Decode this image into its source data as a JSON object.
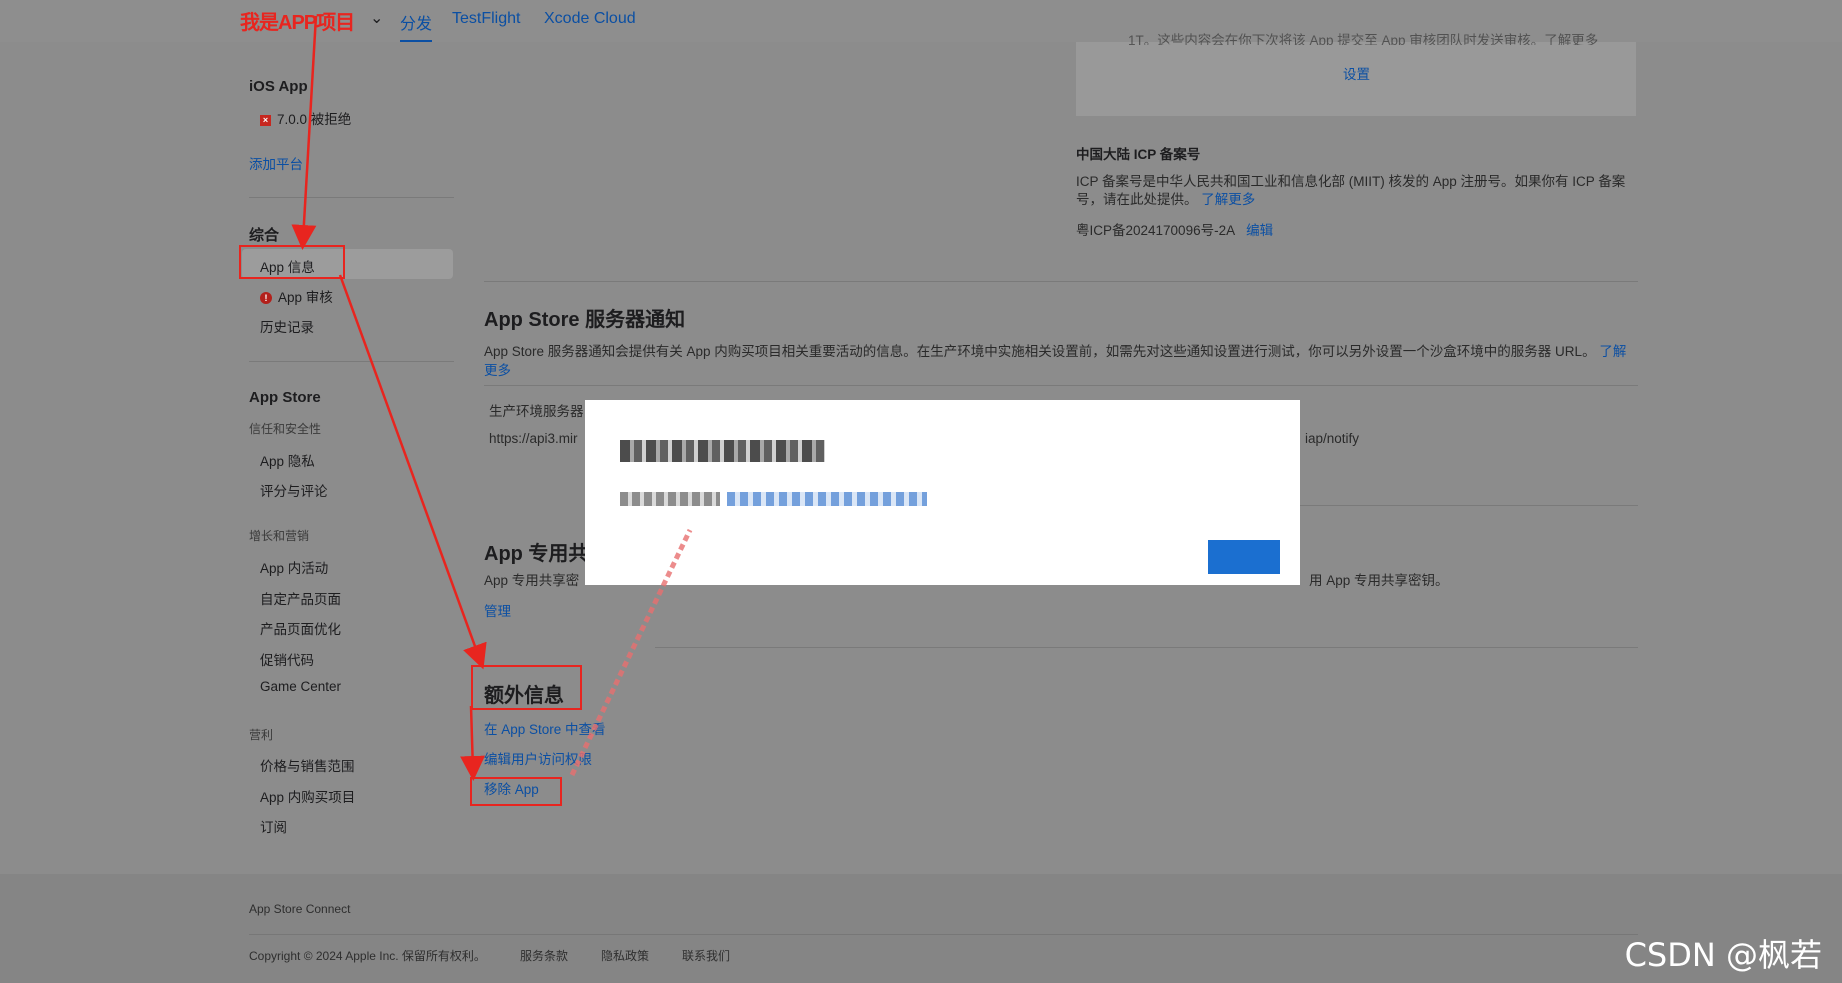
{
  "app_name": "我是APP项目",
  "nav": {
    "tabs": [
      "分发",
      "TestFlight",
      "Xcode Cloud"
    ]
  },
  "sidebar": {
    "ios_app_heading": "iOS App",
    "version_status": "7.0.0 被拒绝",
    "add_platform": "添加平台",
    "general_heading": "综合",
    "general_items": [
      "App 信息",
      "App 审核",
      "历史记录"
    ],
    "appstore_heading": "App Store",
    "trust_sub": "信任和安全性",
    "trust_items": [
      "App 隐私",
      "评分与评论"
    ],
    "growth_sub": "增长和营销",
    "growth_items": [
      "App 内活动",
      "自定产品页面",
      "产品页面优化",
      "促销代码",
      "Game Center"
    ],
    "monetize_sub": "营利",
    "monetize_items": [
      "价格与销售范围",
      "App 内购买项目",
      "订阅"
    ]
  },
  "main": {
    "top_truncated_text": "1T。这些内容会在你下次将该 App 提交至 App 审核团队时发送审核。了解更多",
    "settings_link": "设置",
    "icp_title": "中国大陆 ICP 备案号",
    "icp_desc_1": "ICP 备案号是中华人民共和国工业和信息化部 (MIIT) 核发的 App 注册号。如果你有 ICP 备案",
    "icp_desc_2": "号，请在此处提供。",
    "icp_learn_more": "了解更多",
    "icp_number": "粤ICP备2024170096号-2A",
    "icp_edit": "编辑",
    "server_title": "App Store 服务器通知",
    "server_desc": "App Store 服务器通知会提供有关 App 内购买项目相关重要活动的信息。在生产环境中实施相关设置前，如需先对这些通知设置进行测试，你可以另外设置一个沙盒环境中的服务器 URL。",
    "server_learn_more": "了解更多",
    "prod_server_label": "生产环境服务器",
    "prod_server_url": "https://api3.mir",
    "prod_server_url_tail": "iap/notify",
    "shared_secret_title": "App 专用共",
    "shared_secret_desc": "App 专用共享密",
    "shared_secret_desc_tail": "用 App 专用共享密钥。",
    "manage_link": "管理",
    "extra_title": "额外信息",
    "extra_links": [
      "在 App Store 中查看",
      "编辑用户访问权限",
      "移除 App"
    ]
  },
  "footer": {
    "brand": "App Store Connect",
    "copyright": "Copyright © 2024 Apple Inc. 保留所有权利。",
    "links": [
      "服务条款",
      "隐私政策",
      "联系我们"
    ]
  },
  "watermark": "CSDN @枫若",
  "colors": {
    "accent": "#0b4fa3",
    "annotation": "#e8251f",
    "overlay": "#8c8c8c"
  }
}
